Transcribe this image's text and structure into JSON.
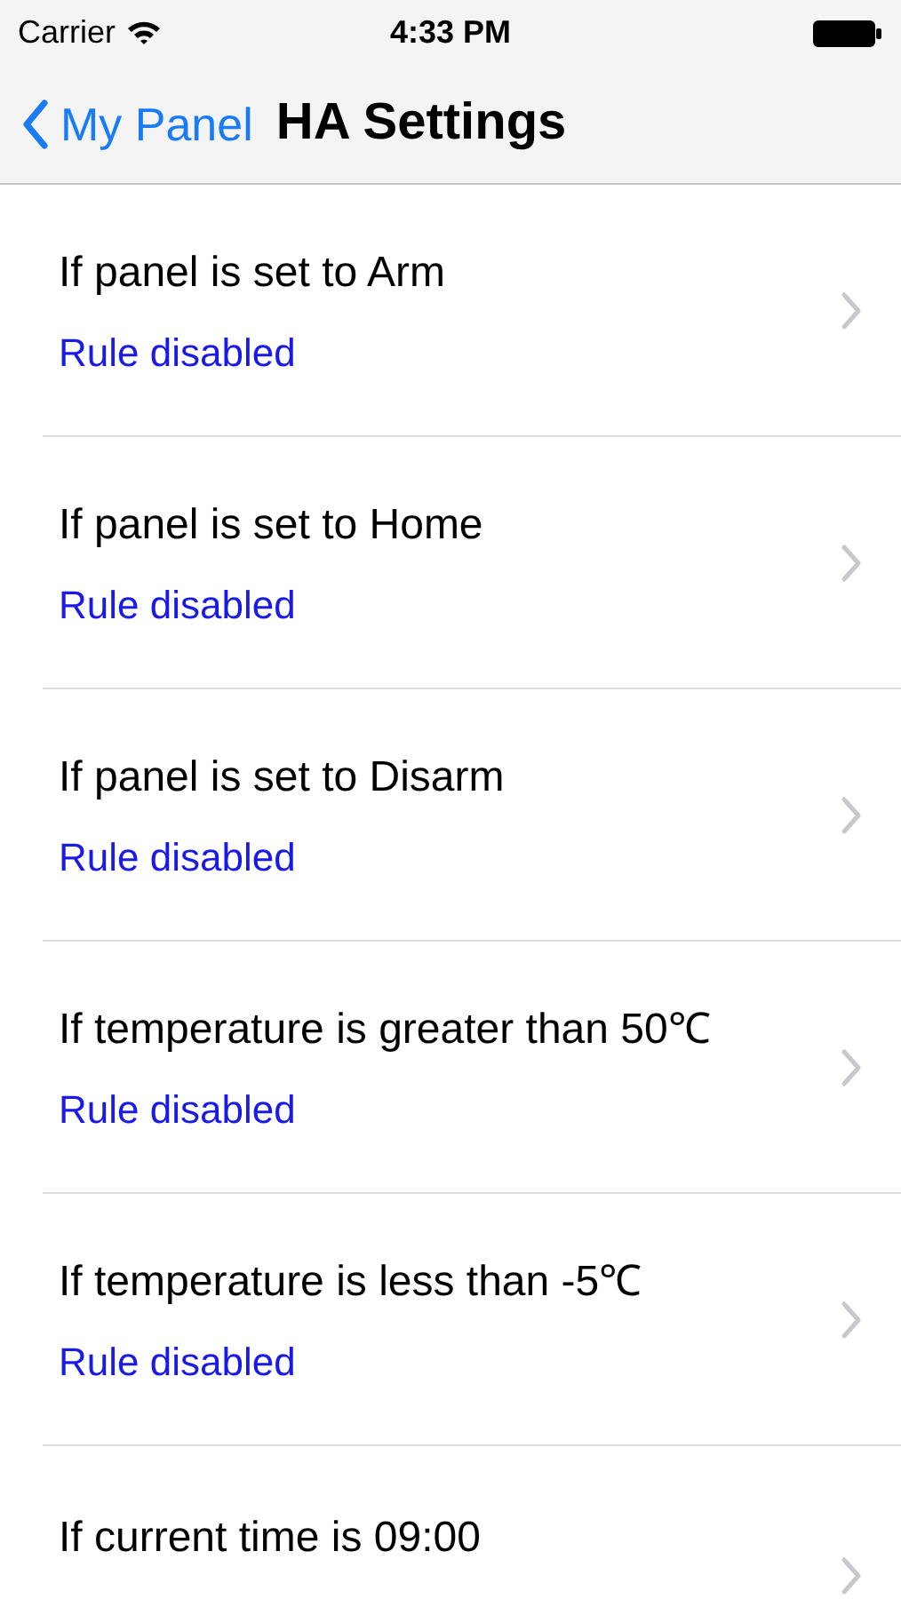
{
  "status_bar": {
    "carrier": "Carrier",
    "time": "4:33 PM"
  },
  "nav_bar": {
    "back_label": "My Panel",
    "title": "HA Settings"
  },
  "rules": [
    {
      "title": "If panel is set to Arm",
      "status": "Rule disabled"
    },
    {
      "title": "If panel is set to Home",
      "status": "Rule disabled"
    },
    {
      "title": "If panel is set to Disarm",
      "status": "Rule disabled"
    },
    {
      "title": "If temperature is greater than 50℃",
      "status": "Rule disabled"
    },
    {
      "title": "If temperature is less than -5℃",
      "status": "Rule disabled"
    },
    {
      "title": "If current time is 09:00"
    }
  ]
}
